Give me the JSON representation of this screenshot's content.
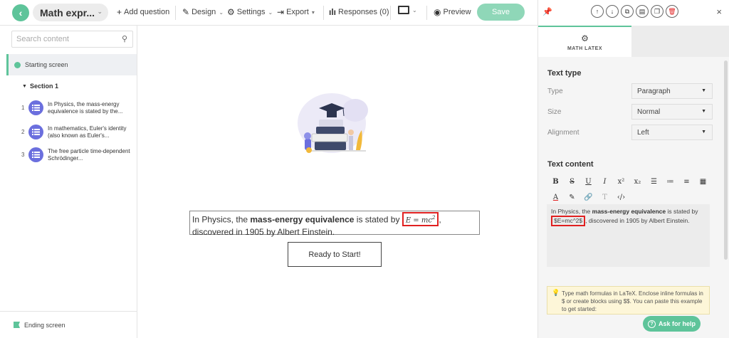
{
  "toolbar": {
    "title": "Math expr...",
    "add_question": "Add question",
    "design": "Design",
    "settings": "Settings",
    "export": "Export",
    "responses": "Responses (0)",
    "preview": "Preview",
    "save": "Save"
  },
  "sidebar": {
    "search_placeholder": "Search content",
    "starting_screen": "Starting screen",
    "section": "Section 1",
    "questions": [
      {
        "num": "1",
        "text": "In Physics, the mass-energy equivalence is stated by the..."
      },
      {
        "num": "2",
        "text": "In mathematics, Euler's identity (also known as Euler's..."
      },
      {
        "num": "3",
        "text": "The free particle time-dependent Schrödinger..."
      }
    ],
    "ending_screen": "Ending screen"
  },
  "canvas": {
    "q_pre": "In Physics, the ",
    "q_bold": "mass-energy equivalence",
    "q_mid": " is stated by ",
    "q_math_base": "E = mc",
    "q_math_sup": "2",
    "q_post": ", discovered in 1905 by Albert Einstein.",
    "start_button": "Ready to Start!"
  },
  "right_panel": {
    "tab_label": "MATH LATEX",
    "text_type_title": "Text type",
    "type_label": "Type",
    "type_value": "Paragraph",
    "size_label": "Size",
    "size_value": "Normal",
    "alignment_label": "Alignment",
    "alignment_value": "Left",
    "text_content_title": "Text content",
    "editor": {
      "pre": "In Physics, the ",
      "bold": "mass-energy equivalence",
      "mid": " is stated by ",
      "math": "$E=mc^2$",
      "post": ", discovered in 1905 by Albert Einstein."
    },
    "tip": "Type math formulas in LaTeX. Enclose inline formulas in $ or create blocks using $$. You can paste this example to get started:",
    "help_button": "Ask for help"
  },
  "colors": {
    "brand_green": "#5ec49a",
    "save_green": "#8fd7b8",
    "question_icon": "#6b6fde",
    "highlight_red": "#e02020"
  }
}
